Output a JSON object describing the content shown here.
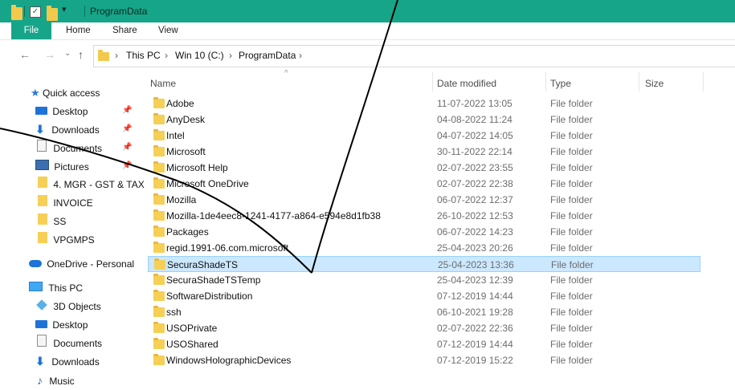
{
  "window": {
    "title": "ProgramData"
  },
  "ribbon": {
    "tabs": [
      "File",
      "Home",
      "Share",
      "View"
    ]
  },
  "address": {
    "crumbs": [
      "This PC",
      "Win 10 (C:)",
      "ProgramData"
    ]
  },
  "sidebar": {
    "quick_access": "Quick access",
    "items": [
      {
        "label": "Desktop",
        "icon": "desktop-icon",
        "pinned": true
      },
      {
        "label": "Downloads",
        "icon": "download-arrow-icon",
        "pinned": true
      },
      {
        "label": "Documents",
        "icon": "document-icon",
        "pinned": true
      },
      {
        "label": "Pictures",
        "icon": "pictures-icon",
        "pinned": true
      },
      {
        "label": "4. MGR - GST & TAX",
        "icon": "folder-icon",
        "pinned": false
      },
      {
        "label": "INVOICE",
        "icon": "folder-icon",
        "pinned": false
      },
      {
        "label": "SS",
        "icon": "folder-icon",
        "pinned": false
      },
      {
        "label": "VPGMPS",
        "icon": "folder-icon",
        "pinned": false
      }
    ],
    "onedrive": "OneDrive - Personal",
    "this_pc": "This PC",
    "pc_items": [
      {
        "label": "3D Objects",
        "icon": "cube-icon"
      },
      {
        "label": "Desktop",
        "icon": "desktop-icon"
      },
      {
        "label": "Documents",
        "icon": "document-icon"
      },
      {
        "label": "Downloads",
        "icon": "download-arrow-icon"
      },
      {
        "label": "Music",
        "icon": "music-note-icon"
      }
    ]
  },
  "columns": {
    "name": "Name",
    "date": "Date modified",
    "type": "Type",
    "size": "Size"
  },
  "files": [
    {
      "name": "Adobe",
      "date": "11-07-2022 13:05",
      "type": "File folder"
    },
    {
      "name": "AnyDesk",
      "date": "04-08-2022 11:24",
      "type": "File folder"
    },
    {
      "name": "Intel",
      "date": "04-07-2022 14:05",
      "type": "File folder"
    },
    {
      "name": "Microsoft",
      "date": "30-11-2022 22:14",
      "type": "File folder"
    },
    {
      "name": "Microsoft Help",
      "date": "02-07-2022 23:55",
      "type": "File folder"
    },
    {
      "name": "Microsoft OneDrive",
      "date": "02-07-2022 22:38",
      "type": "File folder"
    },
    {
      "name": "Mozilla",
      "date": "06-07-2022 12:37",
      "type": "File folder"
    },
    {
      "name": "Mozilla-1de4eec8-1241-4177-a864-e594e8d1fb38",
      "date": "26-10-2022 12:53",
      "type": "File folder"
    },
    {
      "name": "Packages",
      "date": "06-07-2022 14:23",
      "type": "File folder"
    },
    {
      "name": "regid.1991-06.com.microsoft",
      "date": "25-04-2023 20:26",
      "type": "File folder"
    },
    {
      "name": "SecuraShadeTS",
      "date": "25-04-2023 13:36",
      "type": "File folder",
      "selected": true
    },
    {
      "name": "SecuraShadeTSTemp",
      "date": "25-04-2023 12:39",
      "type": "File folder"
    },
    {
      "name": "SoftwareDistribution",
      "date": "07-12-2019 14:44",
      "type": "File folder"
    },
    {
      "name": "ssh",
      "date": "06-10-2021 19:28",
      "type": "File folder"
    },
    {
      "name": "USOPrivate",
      "date": "02-07-2022 22:36",
      "type": "File folder"
    },
    {
      "name": "USOShared",
      "date": "07-12-2019 14:44",
      "type": "File folder"
    },
    {
      "name": "WindowsHolographicDevices",
      "date": "07-12-2019 15:22",
      "type": "File folder"
    }
  ],
  "colors": {
    "titlebar": "#17a589",
    "selection": "#cce8ff",
    "folder": "#f6cf57"
  }
}
